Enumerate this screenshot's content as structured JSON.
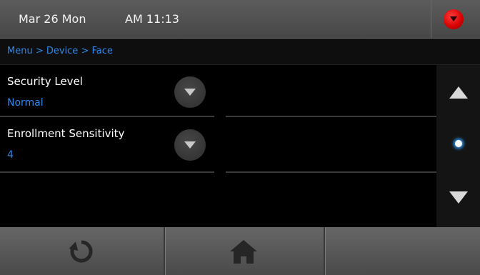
{
  "status_bar": {
    "date": "Mar 26 Mon",
    "time": "AM 11:13",
    "alert_icon": "red-down-arrow-icon"
  },
  "breadcrumb": {
    "path": "Menu > Device > Face"
  },
  "settings": [
    {
      "label": "Security Level",
      "value": "Normal",
      "control_icon": "chevron-down-icon"
    },
    {
      "label": "Enrollment Sensitivity",
      "value": "4",
      "control_icon": "chevron-down-icon"
    }
  ],
  "scroll": {
    "up_icon": "scroll-up-icon",
    "indicator_icon": "page-indicator-dot",
    "down_icon": "scroll-down-icon"
  },
  "bottom_nav": {
    "back_icon": "refresh-back-icon",
    "home_icon": "home-icon"
  },
  "colors": {
    "accent": "#2f87e8",
    "alert": "#d40000",
    "background": "#000000",
    "bar": "#4a4a4a"
  }
}
